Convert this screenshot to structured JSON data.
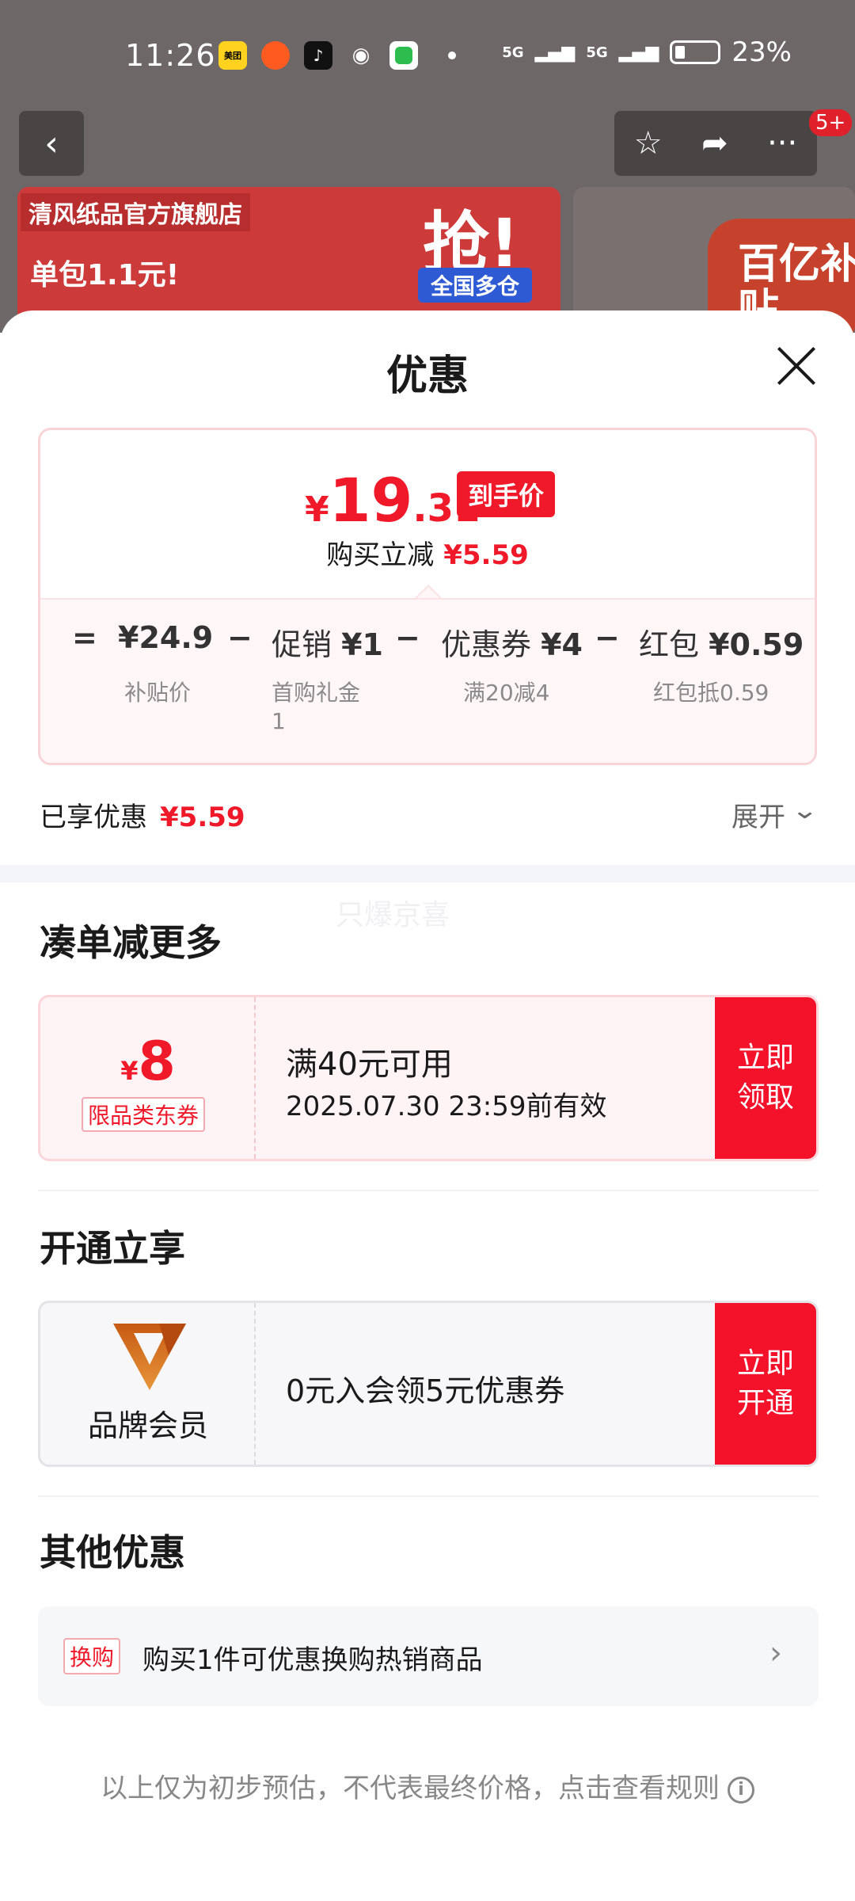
{
  "status_bar": {
    "time": "11:26",
    "battery": "23%",
    "signal1": "5G",
    "signal2": "5G",
    "app_icons": [
      "美团",
      "taobao",
      "douyin",
      "wechat",
      "green-app"
    ]
  },
  "header": {
    "badge": "5+"
  },
  "banner": {
    "shop_name": "清风纸品官方旗舰店",
    "grab": "抢!",
    "promo1": "单包1.1元!",
    "promo2": "全国多仓",
    "baiyi": "百亿补贴"
  },
  "sheet": {
    "title": "优惠",
    "price": {
      "yen": "¥",
      "int": "19",
      "dec": ".31",
      "tag": "到手价",
      "sub_label": "购买立减",
      "sub_value": "¥5.59"
    },
    "calc": {
      "eq": "=",
      "items": [
        {
          "value": "¥24.9",
          "label": "补贴价"
        },
        {
          "name": "促销",
          "value": "¥1",
          "label": "首购礼金",
          "label2": "1"
        },
        {
          "name": "优惠券",
          "value": "¥4",
          "label": "满20减4"
        },
        {
          "name": "红包",
          "value": "¥0.59",
          "label": "红包抵0.59"
        }
      ],
      "minus": "−"
    },
    "enjoyed_label": "已享优惠",
    "enjoyed_value": "¥5.59",
    "expand_label": "展开",
    "watermark": "只爆京喜"
  },
  "section_more": {
    "title": "凑单减更多",
    "coupon": {
      "yen": "¥",
      "amount": "8",
      "tag": "限品类东券",
      "line1": "满40元可用",
      "line2": "2025.07.30 23:59前有效",
      "button": "立即领取",
      "button_l1": "立即",
      "button_l2": "领取"
    }
  },
  "section_member": {
    "title": "开通立享",
    "brand": "品牌会员",
    "text": "0元入会领5元优惠券",
    "button_l1": "立即",
    "button_l2": "开通"
  },
  "section_other": {
    "title": "其他优惠",
    "tag": "换购",
    "text": "购买1件可优惠换购热销商品"
  },
  "disclaimer": "以上仅为初步预估，不代表最终价格，点击查看规则",
  "colors": {
    "accent_red": "#f0192a",
    "button_red": "#f4122a",
    "logo_orange": "#d9731e"
  }
}
